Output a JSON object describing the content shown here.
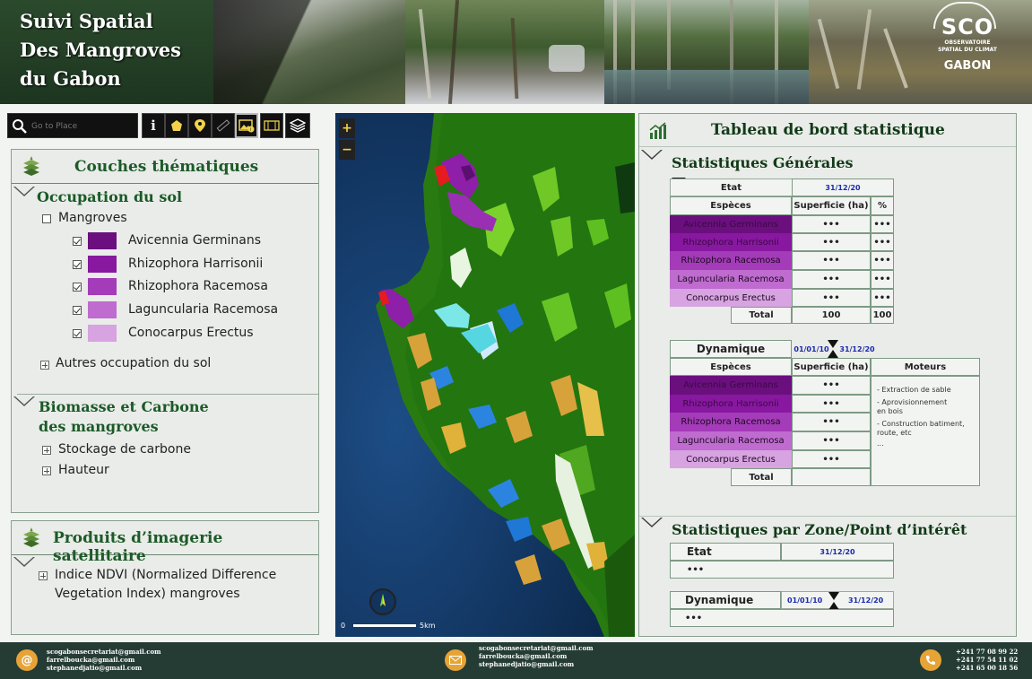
{
  "banner": {
    "title_lines": [
      "Suivi Spatial",
      "Des Mangroves",
      "du Gabon"
    ],
    "logo": {
      "abbr": "SCO",
      "line1": "OBSERVATOIRE",
      "line2": "SPATIAL DU CLIMAT",
      "country": "GABON"
    }
  },
  "toolbar": {
    "search_placeholder": "Go to Place",
    "buttons": [
      "info-icon",
      "pentagon-icon",
      "pin-icon",
      "ruler-icon",
      "image-info-icon",
      "film-icon",
      "layers-icon"
    ]
  },
  "couches": {
    "title": "Couches thématiques",
    "occupation": {
      "title": "Occupation du sol",
      "mangroves_label": "Mangroves",
      "species": [
        {
          "label": "Avicennia Germinans",
          "color": "#6b0f7e",
          "checked": true
        },
        {
          "label": "Rhizophora Harrisonii",
          "color": "#8818a0",
          "checked": true
        },
        {
          "label": "Rhizophora Racemosa",
          "color": "#a43bb8",
          "checked": true
        },
        {
          "label": "Laguncularia Racemosa",
          "color": "#bf6bcf",
          "checked": true
        },
        {
          "label": "Conocarpus Erectus",
          "color": "#d7a3e0",
          "checked": true
        }
      ],
      "autres_label": "Autres occupation du sol"
    },
    "biomasse": {
      "title_line1": "Biomasse et Carbone",
      "title_line2": "des mangroves",
      "items": [
        "Stockage de carbone",
        "Hauteur"
      ]
    }
  },
  "produits": {
    "title": "Produits d’imagerie satellitaire",
    "item_line1": "Indice NDVI (Normalized Difference",
    "item_line2": "Vegetation Index) mangroves"
  },
  "map": {
    "zoom_in": "+",
    "zoom_out": "−",
    "scale_start": "0",
    "scale_end": "5km"
  },
  "stats": {
    "title": "Tableau de bord statistique",
    "generales_title": "Statistiques Générales",
    "etat": {
      "label": "Etat",
      "date": "31/12/20",
      "col_especes": "Espèces",
      "col_superficie": "Superficie (ha)",
      "col_pct": "%",
      "rows": [
        {
          "name": "Avicennia Germinans",
          "sup": "•••",
          "pct": "•••",
          "color": "#6b0f7e"
        },
        {
          "name": "Rhizophora Harrisonii",
          "sup": "•••",
          "pct": "•••",
          "color": "#8818a0"
        },
        {
          "name": "Rhizophora Racemosa",
          "sup": "•••",
          "pct": "•••",
          "color": "#a43bb8"
        },
        {
          "name": "Laguncularia Racemosa",
          "sup": "•••",
          "pct": "•••",
          "color": "#bf6bcf"
        },
        {
          "name": "Conocarpus Erectus",
          "sup": "•••",
          "pct": "•••",
          "color": "#d7a3e0"
        }
      ],
      "total_label": "Total",
      "total_sup": "100",
      "total_pct": "100"
    },
    "dynamique": {
      "label": "Dynamique",
      "date_from": "01/01/10",
      "date_to": "31/12/20",
      "col_especes": "Espèces",
      "col_superficie": "Superficie (ha)",
      "col_moteurs": "Moteurs",
      "rows": [
        {
          "name": "Avicennia Germinans",
          "sup": "•••"
        },
        {
          "name": "Rhizophora Harrisonii",
          "sup": "•••"
        },
        {
          "name": "Rhizophora Racemosa",
          "sup": "•••"
        },
        {
          "name": "Laguncularia Racemosa",
          "sup": "•••"
        },
        {
          "name": "Conocarpus Erectus",
          "sup": "•••"
        }
      ],
      "total_label": "Total",
      "moteurs": [
        "- Extraction de sable",
        "- Aprovisionnement en bois",
        "- Construction batiment, route, etc",
        "..."
      ]
    },
    "zone_title": "Statistiques par Zone/Point d’intérêt",
    "zone_etat": {
      "label": "Etat",
      "date": "31/12/20",
      "value": "•••"
    },
    "zone_dyn": {
      "label": "Dynamique",
      "date_from": "01/01/10",
      "date_to": "31/12/20",
      "value": "•••"
    }
  },
  "footer": {
    "emails": [
      "scogabonsecretariat@gmail.com",
      "farrelboucka@gmail.com",
      "stephanedjatio@gmail.com"
    ],
    "emails2": [
      "scogabonsecretariat@gmail.com",
      "farrelboucka@gmail.com",
      "stephanedjatio@gmail.com"
    ],
    "phones": [
      "+241 77 08 99 22",
      "+241 77 54 11 02",
      "+241 65 00 18 56"
    ]
  }
}
